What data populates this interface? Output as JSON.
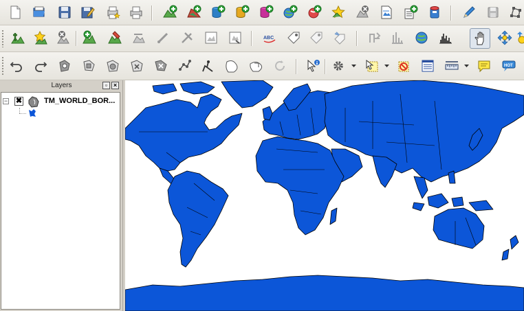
{
  "toolbars": {
    "file": [
      "new-project",
      "open-project",
      "save-project",
      "save-as",
      "new-print-composer",
      "print",
      "add-vector-layer",
      "add-raster-layer",
      "add-postgis-layer",
      "add-spatialite-layer",
      "add-mssql-layer",
      "add-wms-layer",
      "add-wcs-layer",
      "add-wfs-layer",
      "remove-layer",
      "new-shapefile-layer",
      "add-delimited-text-layer",
      "new-spatialite-layer",
      "toggle-editing",
      "save-edits",
      "node-tool"
    ],
    "layer": [
      "add-vector-layer-2",
      "remove-layer-2",
      "add-raster-layer-2",
      "add-vector-layer-3",
      "digitize-polygon",
      "digitize-line",
      "digitize-point",
      "zoom-to-layer",
      "zoom-to-selection",
      "spell-check",
      "label-tool",
      "pin-label",
      "move-label",
      "rotate-label",
      "raster-histogram",
      "identify-globe",
      "histogram-chart",
      "pan",
      "zoom-full-extent"
    ],
    "digitize": [
      "undo",
      "redo",
      "add-ring",
      "add-part",
      "fill-ring",
      "delete-ring",
      "delete-part",
      "split-features",
      "simplify",
      "reshape",
      "offset-curve",
      "rotate",
      "identify",
      "action",
      "select",
      "deselect",
      "attribute-table",
      "measure",
      "annotation",
      "map-tips"
    ]
  },
  "layers_panel": {
    "title": "Layers",
    "layers": [
      {
        "name": "TM_WORLD_BOR...",
        "visible": true,
        "expanded": true,
        "fill_color": "#0c56d8"
      }
    ]
  },
  "map": {
    "fill_color": "#0c56d8",
    "background": "#ffffff"
  }
}
